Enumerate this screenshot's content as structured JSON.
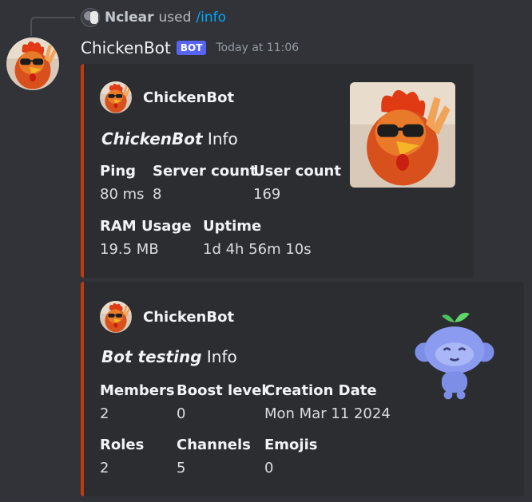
{
  "reply": {
    "user": "Nclear",
    "used_text": "used",
    "command": "/info"
  },
  "message": {
    "author": "ChickenBot",
    "bot_tag": "BOT",
    "timestamp": "Today at 11:06"
  },
  "embeds": [
    {
      "author": "ChickenBot",
      "title_emphasis": "ChickenBot",
      "title_rest": " Info",
      "accent_color": "#c23a0c",
      "fields_row1": [
        {
          "name": "Ping",
          "value": "80 ms"
        },
        {
          "name": "Server count",
          "value": "8"
        },
        {
          "name": "User count",
          "value": "169"
        }
      ],
      "fields_row2": [
        {
          "name": "RAM Usage",
          "value": "19.5 MB"
        },
        {
          "name": "Uptime",
          "value": "1d 4h 56m 10s"
        }
      ],
      "thumbnail_icon": "chicken-with-sunglasses-icon"
    },
    {
      "author": "ChickenBot",
      "title_emphasis": "Bot testing",
      "title_rest": " Info",
      "accent_color": "#c23a0c",
      "fields_row1": [
        {
          "name": "Members",
          "value": "2"
        },
        {
          "name": "Boost level",
          "value": "0"
        },
        {
          "name": "Creation Date",
          "value": "Mon Mar 11 2024"
        }
      ],
      "fields_row2": [
        {
          "name": "Roles",
          "value": "2"
        },
        {
          "name": "Channels",
          "value": "5"
        },
        {
          "name": "Emojis",
          "value": "0"
        }
      ],
      "thumbnail_icon": "blue-sprout-mascot-icon"
    }
  ],
  "colors": {
    "background": "#313338",
    "embed_background": "#2b2d31",
    "bot_tag": "#5865f2",
    "command_link": "#00a8fc"
  }
}
